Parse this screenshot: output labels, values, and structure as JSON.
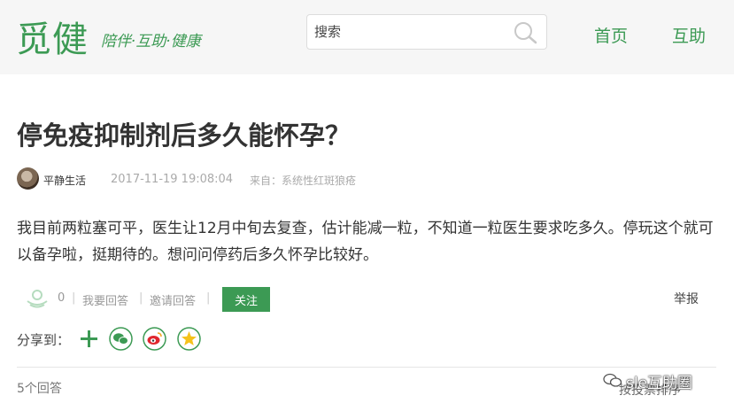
{
  "header": {
    "logo": "觅健",
    "slogan": "陪伴·互助·健康",
    "search": {
      "placeholder": "搜索"
    },
    "nav": [
      {
        "label": "首页"
      },
      {
        "label": "互助"
      }
    ]
  },
  "question": {
    "title": "停免疫抑制剂后多久能怀孕？",
    "author": "平静生活",
    "time": "2017-11-19 19:08:04",
    "source": "来自：系统性红斑狼疮",
    "content": "我目前两粒塞可平，医生让12月中旬去复查，估计能减一粒，不知道一粒医生要求吃多久。停玩这个就可以备孕啦，挺期待的。想问问停药后多久怀孕比较好。"
  },
  "actions": {
    "like_count": "0",
    "answer_label": "我要回答",
    "invite_label": "邀请回答",
    "follow_label": "关注",
    "report_label": "举报"
  },
  "share": {
    "label": "分享到：",
    "icons": [
      "plus-icon",
      "wechat-icon",
      "weibo-icon",
      "qzone-icon"
    ]
  },
  "answers": {
    "count_label": "5个回答",
    "sort_label": "按投票排序"
  },
  "watermark": {
    "text": "sle互助圈"
  },
  "colors": {
    "brand_green": "#3c9a54",
    "topbar_bg": "#f6f6f6"
  }
}
